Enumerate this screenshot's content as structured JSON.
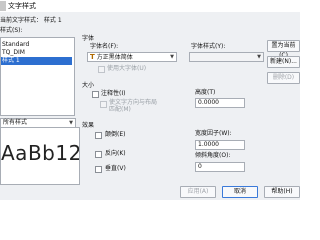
{
  "window": {
    "title": "文字样式"
  },
  "styles_panel": {
    "current_style_label": "当前文字样式：  样式 1",
    "styles_label": "样式(S):",
    "items": [
      "Standard",
      "TQ_DIM",
      "样式 1"
    ],
    "selected_index": 2,
    "filter_value": "所有样式"
  },
  "font_section": {
    "heading": "字体",
    "font_name_label": "字体名(F):",
    "font_name_value": "方正黑体简体",
    "font_style_label": "字体样式(Y):",
    "big_font_label": "使用大字体(U)"
  },
  "size_section": {
    "heading": "大小",
    "annotative_label": "注释性(I)",
    "match_orientation_label": "使文字方向与布局",
    "match_orientation_label2": "匹配(M)",
    "height_label": "高度(T)",
    "height_value": "0.0000"
  },
  "effects_section": {
    "heading": "效果",
    "upside_down_label": "颠倒(E)",
    "backwards_label": "反向(K)",
    "vertical_label": "垂直(V)",
    "width_factor_label": "宽度因子(W):",
    "width_factor_value": "1.0000",
    "oblique_label": "倾斜角度(O):",
    "oblique_value": "0"
  },
  "preview": {
    "sample_text": "AaBb12"
  },
  "buttons": {
    "set_current": "置为当前(C)",
    "new": "新建(N)...",
    "delete": "删除(D)",
    "apply": "应用(A)",
    "cancel": "取消",
    "help": "帮助(H)"
  }
}
